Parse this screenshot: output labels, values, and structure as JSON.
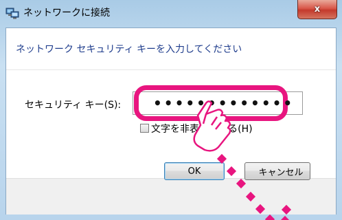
{
  "window": {
    "title": "ネットワークに接続",
    "close_label": "x"
  },
  "dialog": {
    "header": "ネットワーク セキュリティ キーを入力してください",
    "security_key_label": "セキュリティ キー(S):",
    "security_key_value": "•••••••••••••",
    "hide_characters_label": "文字を非表示にする(H)",
    "hide_characters_checked": false
  },
  "buttons": {
    "ok_label": "OK",
    "cancel_label": "キャンセル"
  },
  "annotation": {
    "highlight_color": "#e8157f"
  }
}
